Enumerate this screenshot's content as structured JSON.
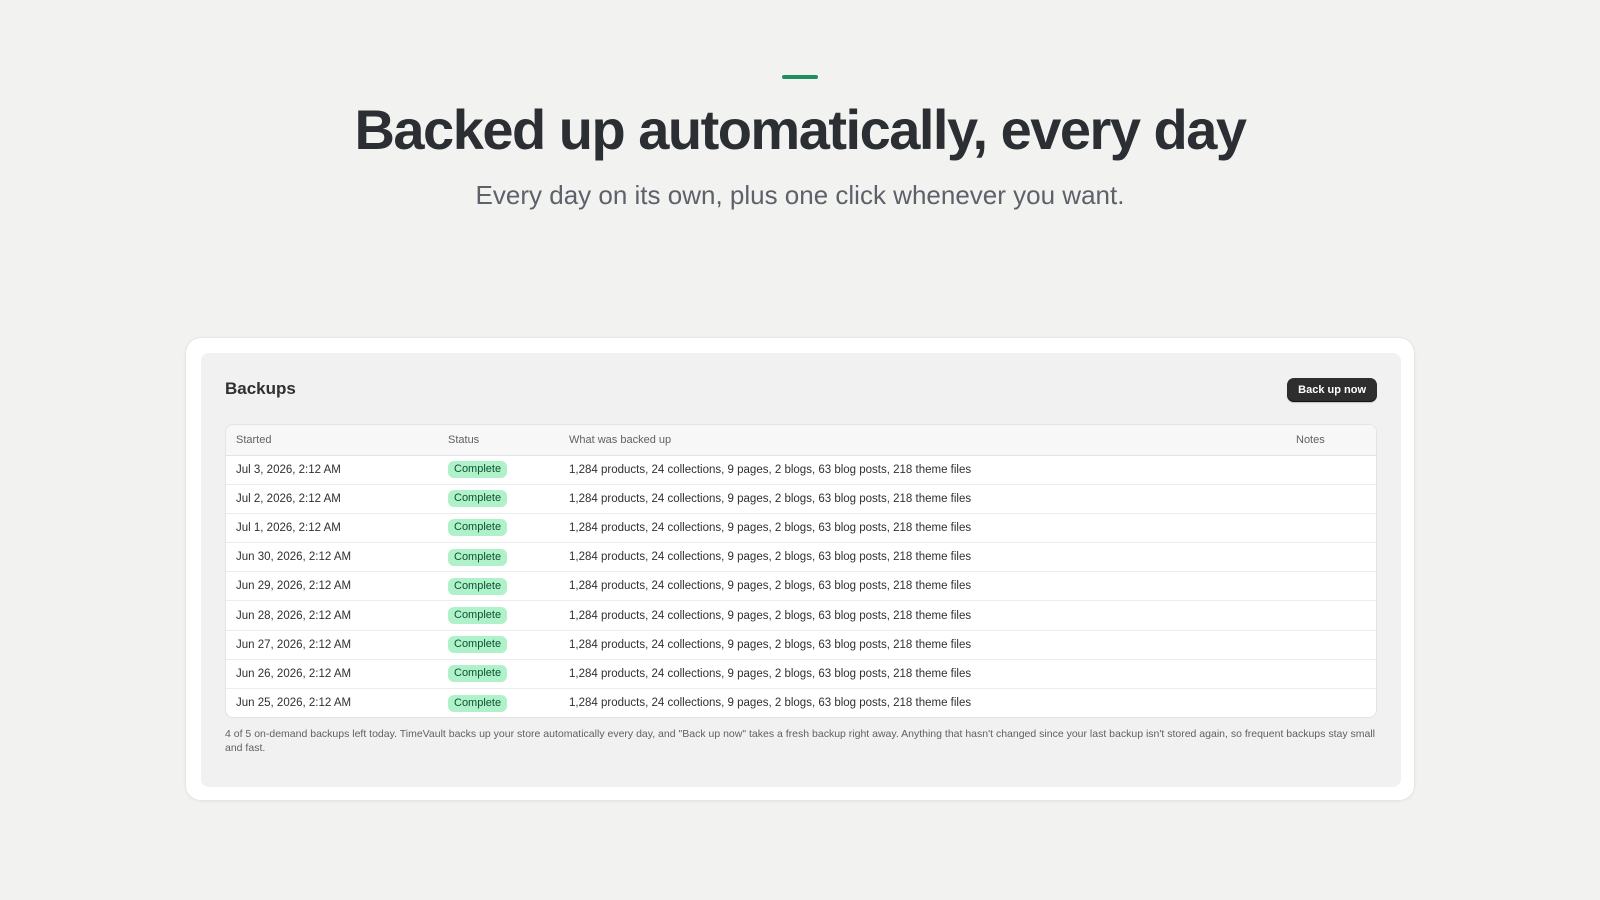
{
  "hero": {
    "accent_color": "#1f8f5f",
    "headline": "Backed up automatically, every day",
    "subhead": "Every day on its own, plus one click whenever you want."
  },
  "card": {
    "title": "Backups",
    "button_label": "Back up now",
    "columns": {
      "started": "Started",
      "status": "Status",
      "what": "What was backed up",
      "notes": "Notes"
    },
    "rows": [
      {
        "started": "Jul 3, 2026, 2:12 AM",
        "status": "Complete",
        "what": "1,284 products, 24 collections, 9 pages, 2 blogs, 63 blog posts, 218 theme files",
        "notes": ""
      },
      {
        "started": "Jul 2, 2026, 2:12 AM",
        "status": "Complete",
        "what": "1,284 products, 24 collections, 9 pages, 2 blogs, 63 blog posts, 218 theme files",
        "notes": ""
      },
      {
        "started": "Jul 1, 2026, 2:12 AM",
        "status": "Complete",
        "what": "1,284 products, 24 collections, 9 pages, 2 blogs, 63 blog posts, 218 theme files",
        "notes": ""
      },
      {
        "started": "Jun 30, 2026, 2:12 AM",
        "status": "Complete",
        "what": "1,284 products, 24 collections, 9 pages, 2 blogs, 63 blog posts, 218 theme files",
        "notes": ""
      },
      {
        "started": "Jun 29, 2026, 2:12 AM",
        "status": "Complete",
        "what": "1,284 products, 24 collections, 9 pages, 2 blogs, 63 blog posts, 218 theme files",
        "notes": ""
      },
      {
        "started": "Jun 28, 2026, 2:12 AM",
        "status": "Complete",
        "what": "1,284 products, 24 collections, 9 pages, 2 blogs, 63 blog posts, 218 theme files",
        "notes": ""
      },
      {
        "started": "Jun 27, 2026, 2:12 AM",
        "status": "Complete",
        "what": "1,284 products, 24 collections, 9 pages, 2 blogs, 63 blog posts, 218 theme files",
        "notes": ""
      },
      {
        "started": "Jun 26, 2026, 2:12 AM",
        "status": "Complete",
        "what": "1,284 products, 24 collections, 9 pages, 2 blogs, 63 blog posts, 218 theme files",
        "notes": ""
      },
      {
        "started": "Jun 25, 2026, 2:12 AM",
        "status": "Complete",
        "what": "1,284 products, 24 collections, 9 pages, 2 blogs, 63 blog posts, 218 theme files",
        "notes": ""
      }
    ],
    "status_color": "#aff1c8",
    "footnote": "4 of 5 on-demand backups left today. TimeVault backs up your store automatically every day, and \"Back up now\" takes a fresh backup right away. Anything that hasn't changed since your last backup isn't stored again, so frequent backups stay small and fast."
  }
}
